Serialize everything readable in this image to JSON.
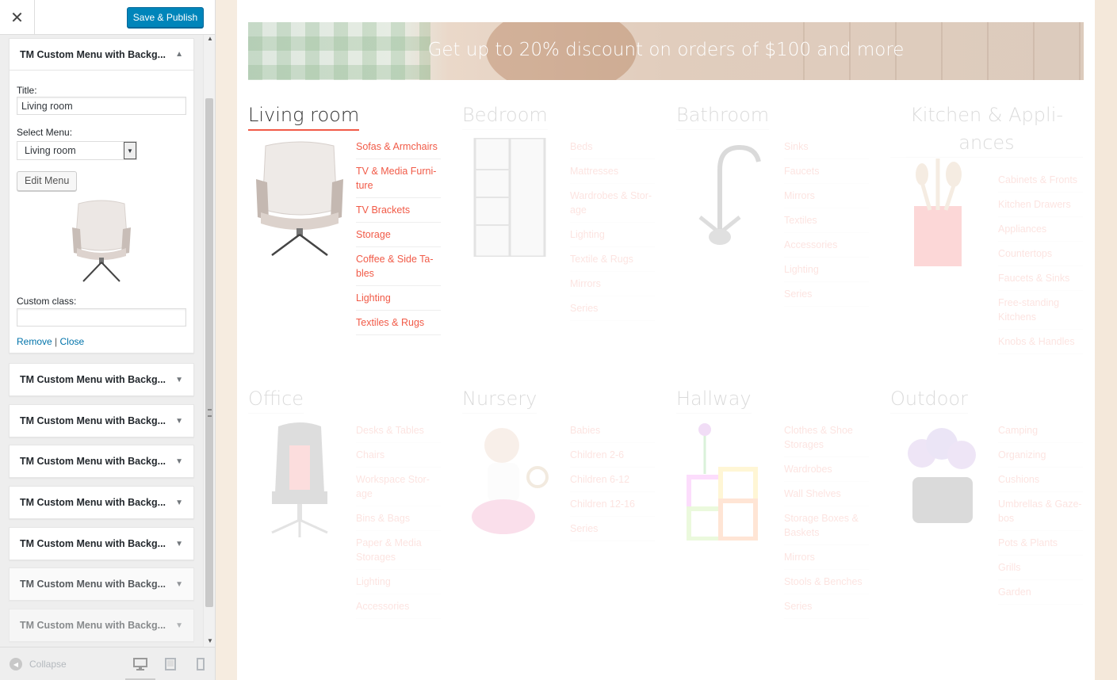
{
  "header": {
    "close_icon": "close-icon",
    "save_label": "Save & Publish"
  },
  "widget_open": {
    "title": "TM Custom Menu with Backg...",
    "title_label": "Title:",
    "title_value": "Living room",
    "menu_label": "Select Menu:",
    "menu_value": "Living room",
    "edit_button": "Edit Menu",
    "custom_class_label": "Custom class:",
    "custom_class_value": "",
    "remove_link": "Remove",
    "separator": "|",
    "close_link": "Close"
  },
  "widgets_collapsed": [
    "TM Custom Menu with Backg...",
    "TM Custom Menu with Backg...",
    "TM Custom Menu with Backg...",
    "TM Custom Menu with Backg...",
    "TM Custom Menu with Backg...",
    "TM Custom Menu with Backg...",
    "TM Custom Menu with Backg..."
  ],
  "footer": {
    "collapse_label": "Collapse",
    "devices": [
      "desktop-icon",
      "tablet-icon",
      "mobile-icon"
    ]
  },
  "banner": {
    "text": "Get up to 20% discount on orders of $100 and more"
  },
  "categories": [
    {
      "title": "Living room",
      "links": [
        "Sofas & Armchairs",
        "TV & Media Furni-ture",
        "TV Brackets",
        "Storage",
        "Coffee & Side Ta-bles",
        "Lighting",
        "Textiles & Rugs"
      ]
    },
    {
      "title": "Bedroom",
      "links": [
        "Beds",
        "Mattresses",
        "Wardrobes & Stor-age",
        "Lighting",
        "Textile & Rugs",
        "Mirrors",
        "Series"
      ]
    },
    {
      "title": "Bathroom",
      "links": [
        "Sinks",
        "Faucets",
        "Mirrors",
        "Textiles",
        "Accessories",
        "Lighting",
        "Series"
      ]
    },
    {
      "title": "Kitchen & Appli-ances",
      "links": [
        "Cabinets & Fronts",
        "Kitchen Drawers",
        "Appliances",
        "Countertops",
        "Faucets & Sinks",
        "Free-standing Kitchens",
        "Knobs & Handles"
      ]
    },
    {
      "title": "Office",
      "links": [
        "Desks & Tables",
        "Chairs",
        "Workspace Stor-age",
        "Bins & Bags",
        "Paper & Media Storages",
        "Lighting",
        "Accessories"
      ]
    },
    {
      "title": "Nursery",
      "links": [
        "Babies",
        "Children 2-6",
        "Children 6-12",
        "Children 12-16",
        "Series"
      ]
    },
    {
      "title": "Hallway",
      "links": [
        "Clothes & Shoe Storages",
        "Wardrobes",
        "Wall Shelves",
        "Storage Boxes & Baskets",
        "Mirrors",
        "Stools & Benches",
        "Series"
      ]
    },
    {
      "title": "Outdoor",
      "links": [
        "Camping",
        "Organizing",
        "Cushions",
        "Umbrellas & Gaze-bos",
        "Pots & Plants",
        "Grills",
        "Garden"
      ]
    }
  ],
  "colors": {
    "accent": "#f15a47",
    "wp_blue": "#0085ba",
    "link_blue": "#0073aa"
  }
}
